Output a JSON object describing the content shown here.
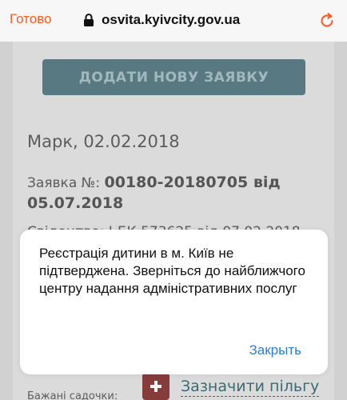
{
  "browser": {
    "done_label": "Готово",
    "url": "osvita.kyivcity.gov.ua",
    "accent_color": "#ff5a1f"
  },
  "page": {
    "add_button_label": "ДОДАТИ НОВУ ЗАЯВКУ",
    "child_name_date": "Марк,  02.02.2018",
    "application_label": "Заявка №: ",
    "application_number": "00180-20180705 від 05.07.2018",
    "certificate_line": "Свідоцтво: І-БК 573625 від 07.02.2018",
    "kindergartens_label": "Бажані садочки:",
    "benefit_link": "Зазначити пільгу"
  },
  "dialog": {
    "message": "Реєстрація дитини в м. Київ не підтверджена. Зверніться до найближчого центру надання адміністративних послуг",
    "button_label": "Закрыть",
    "button_color": "#2f7be0"
  },
  "icons": {
    "lock": "lock-icon",
    "reload": "reload-icon",
    "plus": "plus-icon"
  }
}
